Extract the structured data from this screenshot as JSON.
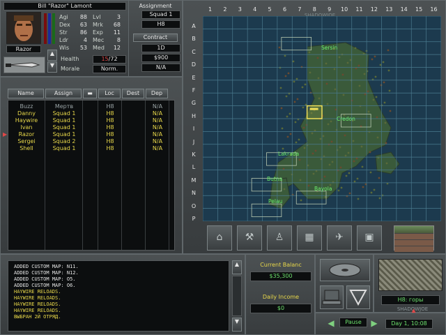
{
  "merc": {
    "full_name": "Bill \"Razor\" Lamont",
    "nickname": "Razor",
    "stats_left": [
      {
        "label": "Agi",
        "value": "88"
      },
      {
        "label": "Dex",
        "value": "63"
      },
      {
        "label": "Str",
        "value": "86"
      },
      {
        "label": "Ldr",
        "value": "4"
      },
      {
        "label": "Wis",
        "value": "53"
      }
    ],
    "stats_right": [
      {
        "label": "Lvl",
        "value": "3"
      },
      {
        "label": "Mrk",
        "value": "68"
      },
      {
        "label": "Exp",
        "value": "11"
      },
      {
        "label": "Mec",
        "value": "8"
      },
      {
        "label": "Med",
        "value": "12"
      }
    ],
    "health_label": "Health",
    "health_current": "15",
    "health_max": "/72",
    "morale_label": "Morale",
    "morale_value": "Norm."
  },
  "assignment": {
    "header": "Assignment",
    "squad": "Squad 1",
    "sector": "H8",
    "contract_label": "Contract",
    "contract_duration": "1D",
    "contract_cost": "$900",
    "contract_extra": "N/A"
  },
  "roster": {
    "columns": [
      "Name",
      "Assign",
      "",
      "Loc",
      "Dest",
      "Dep"
    ],
    "rows": [
      {
        "name": "Buzz",
        "assign": "Мертв",
        "loc": "H8",
        "dest": "",
        "dep": "N/A",
        "style": "dead"
      },
      {
        "name": "Danny",
        "assign": "Squad 1",
        "loc": "H8",
        "dest": "",
        "dep": "N/A",
        "style": "normal"
      },
      {
        "name": "Haywire",
        "assign": "Squad 1",
        "loc": "H8",
        "dest": "",
        "dep": "N/A",
        "style": "normal"
      },
      {
        "name": "Ivan",
        "assign": "Squad 1",
        "loc": "H8",
        "dest": "",
        "dep": "N/A",
        "style": "normal"
      },
      {
        "name": "Razor",
        "assign": "Squad 1",
        "loc": "H8",
        "dest": "",
        "dep": "N/A",
        "style": "selected"
      },
      {
        "name": "Sergei",
        "assign": "Squad 2",
        "loc": "H8",
        "dest": "",
        "dep": "N/A",
        "style": "normal"
      },
      {
        "name": "Shell",
        "assign": "Squad 1",
        "loc": "H8",
        "dest": "",
        "dep": "N/A",
        "style": "normal"
      }
    ]
  },
  "map": {
    "col_labels": [
      "1",
      "2",
      "3",
      "4",
      "5",
      "6",
      "7",
      "8",
      "9",
      "10",
      "11",
      "12",
      "13",
      "14",
      "15",
      "16"
    ],
    "row_labels": [
      "A",
      "B",
      "C",
      "D",
      "E",
      "F",
      "G",
      "H",
      "I",
      "J",
      "K",
      "L",
      "M",
      "N",
      "O",
      "P"
    ],
    "towns": [
      "Sersin",
      "Credon",
      "Lakrada",
      "Butna",
      "Bayola",
      "Pelau"
    ],
    "top_watermark": "SHADOWJOE"
  },
  "map_toolbar": [
    {
      "name": "town-names-icon"
    },
    {
      "name": "shovel-icon"
    },
    {
      "name": "militia-icon"
    },
    {
      "name": "airspace-icon"
    },
    {
      "name": "helicopter-icon"
    },
    {
      "name": "items-icon"
    }
  ],
  "log": [
    {
      "text": "Added custom map: N11.",
      "color": "white"
    },
    {
      "text": "Added custom map: N12.",
      "color": "white"
    },
    {
      "text": "Added custom map: O5.",
      "color": "white"
    },
    {
      "text": "Added custom map: O6.",
      "color": "white"
    },
    {
      "text": "Haywire reloads.",
      "color": "yellow"
    },
    {
      "text": "Haywire reloads.",
      "color": "yellow"
    },
    {
      "text": "Haywire reloads.",
      "color": "yellow"
    },
    {
      "text": "Haywire reloads.",
      "color": "yellow"
    },
    {
      "text": "Выбран 2й отряд.",
      "color": "yellow"
    }
  ],
  "finance": {
    "balance_label": "Current Balanc",
    "balance_value": "$35,300",
    "income_label": "Daily Income",
    "income_value": "$0"
  },
  "sector_info": {
    "sector": "H8: горы",
    "watermark": "SHADOWJOE"
  },
  "time": {
    "pause_label": "Pause",
    "date": "Day 1, 10:08"
  }
}
